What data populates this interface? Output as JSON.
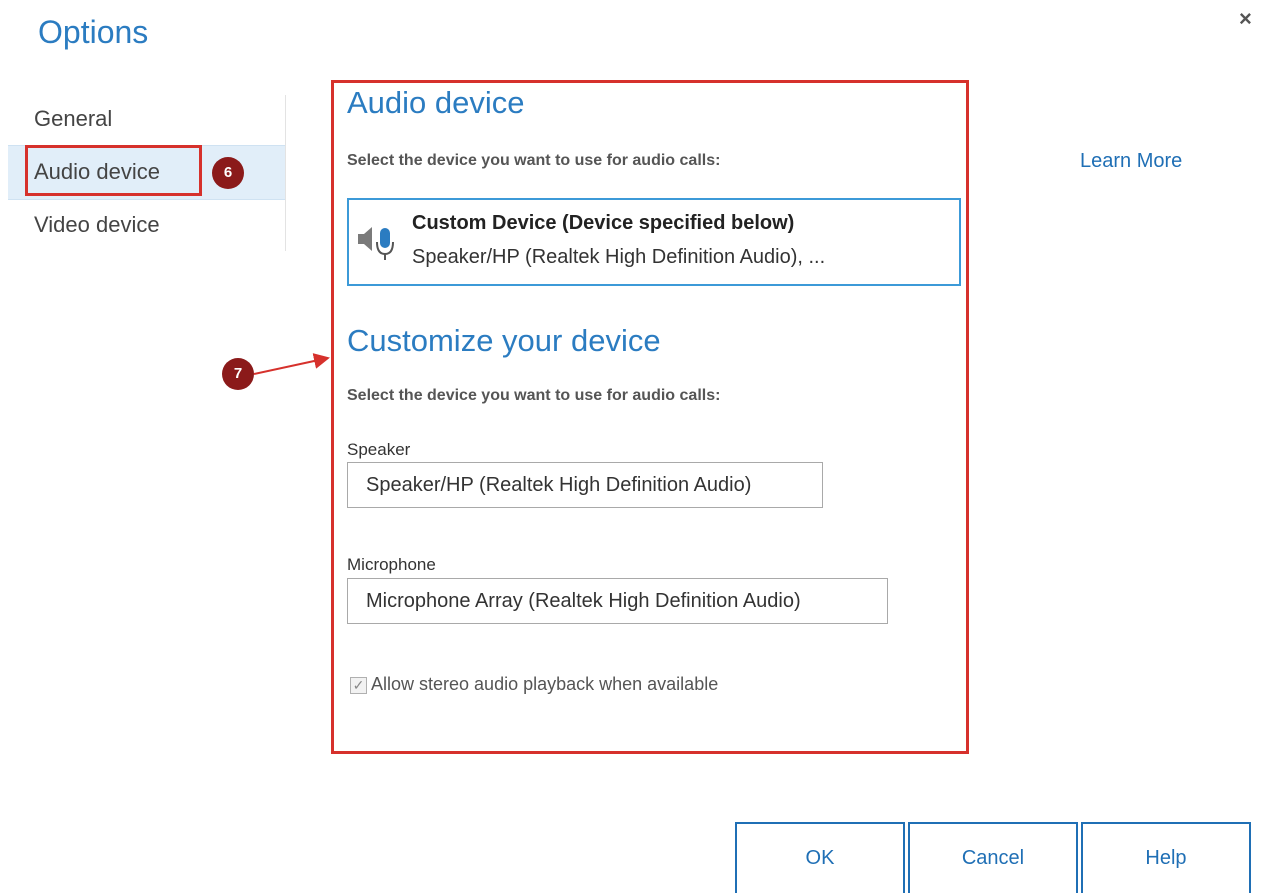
{
  "window": {
    "title": "Options",
    "close_glyph": "×"
  },
  "sidebar": {
    "items": [
      {
        "label": "General"
      },
      {
        "label": "Audio device",
        "selected": true
      },
      {
        "label": "Video device"
      }
    ]
  },
  "annotations": {
    "badge_6": "6",
    "badge_7": "7",
    "color": "#d6312c",
    "badge_color": "#8b1a1a"
  },
  "audio": {
    "heading": "Audio device",
    "instruction": "Select the device you want to use for audio calls:",
    "learn_more": "Learn More",
    "device": {
      "title": "Custom Device (Device specified below)",
      "subtitle": "Speaker/HP (Realtek High Definition Audio), ...",
      "icon": "speaker-microphone-icon"
    }
  },
  "customize": {
    "heading": "Customize your device",
    "instruction": "Select the device you want to use for audio calls:",
    "speaker_label": "Speaker",
    "speaker_value": "Speaker/HP (Realtek High Definition Audio)",
    "microphone_label": "Microphone",
    "microphone_value": "Microphone Array (Realtek High Definition Audio)",
    "stereo_label": "Allow stereo audio playback when available",
    "stereo_checked": true
  },
  "buttons": {
    "ok": "OK",
    "cancel": "Cancel",
    "help": "Help"
  },
  "colors": {
    "accent": "#2b7cc1",
    "link": "#1f6fb5",
    "selection_bg": "#e1eef9"
  }
}
